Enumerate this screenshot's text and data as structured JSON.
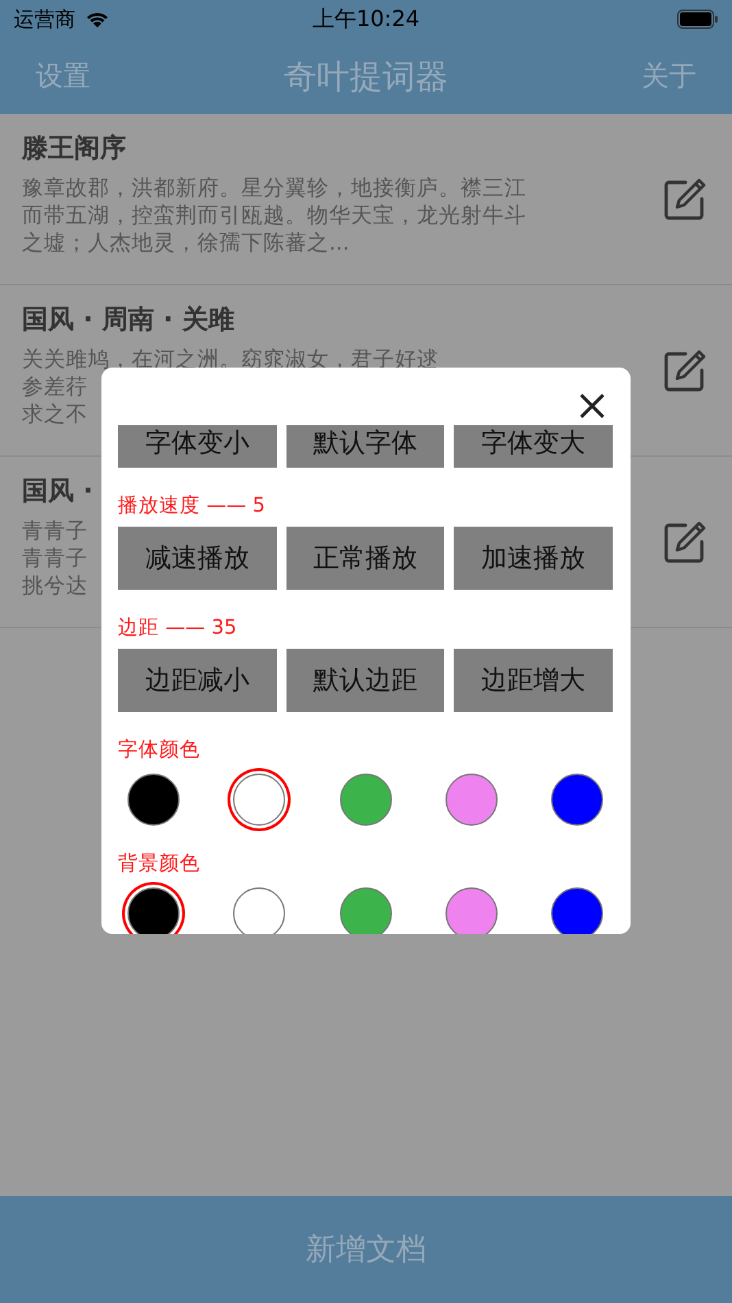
{
  "status_bar": {
    "carrier": "运营商",
    "time": "上午10:24"
  },
  "nav": {
    "left": "设置",
    "title": "奇叶提词器",
    "right": "关于"
  },
  "documents": [
    {
      "title": "滕王阁序",
      "lines": [
        "豫章故郡，洪都新府。星分翼轸，地接衡庐。襟三江",
        "而带五湖，控蛮荆而引瓯越。物华天宝，龙光射牛斗",
        "之墟；人杰地灵，徐孺下陈蕃之..."
      ]
    },
    {
      "title": "国风 · 周南 · 关雎",
      "lines": [
        "关关雎鸠，在河之洲。窈窕淑女，君子好逑",
        "参差荇",
        "求之不"
      ]
    },
    {
      "title": "国风 ·",
      "lines": [
        "青青子",
        "青青子",
        "挑兮达"
      ]
    }
  ],
  "settings": {
    "sections": [
      {
        "kind": "buttons",
        "buttons": [
          "字体变小",
          "默认字体",
          "字体变大"
        ]
      },
      {
        "kind": "buttons",
        "label": "播放速度 —— 5",
        "buttons": [
          "减速播放",
          "正常播放",
          "加速播放"
        ]
      },
      {
        "kind": "buttons",
        "label": "边距 —— 35",
        "buttons": [
          "边距减小",
          "默认边距",
          "边距增大"
        ]
      },
      {
        "kind": "colors",
        "label": "字体颜色",
        "swatches": [
          {
            "color": "#000000",
            "selected": false
          },
          {
            "color": "#ffffff",
            "selected": true
          },
          {
            "color": "#3cb44b",
            "selected": false
          },
          {
            "color": "#ee82ee",
            "selected": false
          },
          {
            "color": "#0000ff",
            "selected": false
          }
        ]
      },
      {
        "kind": "colors",
        "label": "背景颜色",
        "swatches": [
          {
            "color": "#000000",
            "selected": true
          },
          {
            "color": "#ffffff",
            "selected": false
          },
          {
            "color": "#3cb44b",
            "selected": false
          },
          {
            "color": "#ee82ee",
            "selected": false
          },
          {
            "color": "#0000ff",
            "selected": false
          }
        ]
      }
    ]
  },
  "bottom_button": "新增文档"
}
